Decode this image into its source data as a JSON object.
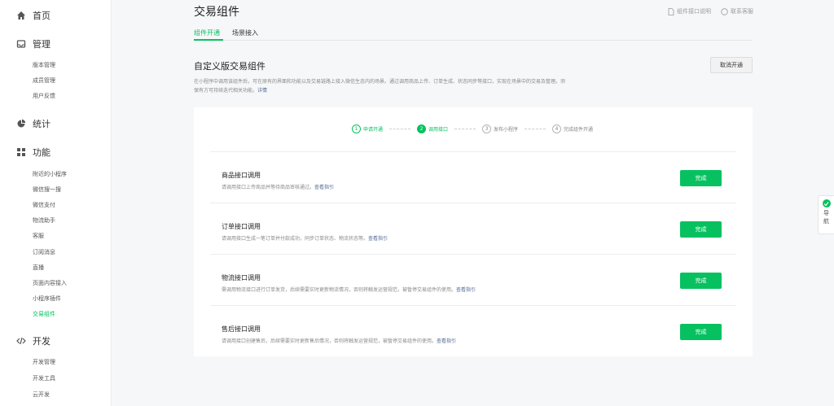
{
  "sidebar": {
    "home": {
      "label": "首页",
      "icon": "home-icon"
    },
    "manage": {
      "label": "管理",
      "icon": "inbox-icon",
      "items": [
        "版本管理",
        "成员管理",
        "用户反馈"
      ]
    },
    "stats": {
      "label": "统计",
      "icon": "pie-chart-icon"
    },
    "features": {
      "label": "功能",
      "icon": "grid-icon",
      "items": [
        "附近的小程序",
        "微信搜一搜",
        "微信支付",
        "物流助手",
        "客服",
        "订阅消息",
        "直播",
        "页面内容接入",
        "小程序插件",
        "交易组件"
      ],
      "active": "交易组件"
    },
    "dev": {
      "label": "开发",
      "icon": "code-icon",
      "items": [
        "开发管理",
        "开发工具",
        "云开发"
      ]
    }
  },
  "header": {
    "title": "交易组件",
    "doc_link": "组件接口说明",
    "contact_link": "联系客服"
  },
  "tabs": [
    {
      "label": "组件开通",
      "active": true
    },
    {
      "label": "场景接入",
      "active": false
    }
  ],
  "section": {
    "title": "自定义版交易组件",
    "cancel_button": "取消开通",
    "description": "在小程序中调用该组件后，可在原有的界面和功能以及交易链路上接入微信生态内的场景。通过调用商品上传、订单生成、状态同步等接口，实现在场景中的交易及管理。须",
    "description_line2": "保有方可持续迭代相关功能。",
    "description_link": "详情"
  },
  "steps": [
    {
      "num": "1",
      "label": "申请开通",
      "state": "done"
    },
    {
      "num": "2",
      "label": "调用接口",
      "state": "current"
    },
    {
      "num": "3",
      "label": "发布小程序",
      "state": "todo"
    },
    {
      "num": "4",
      "label": "完成组件开通",
      "state": "todo"
    }
  ],
  "rows": [
    {
      "title": "商品接口调用",
      "desc": "请调用接口上传商品并等待商品审核通过。",
      "link": "查看指引",
      "button": "完成"
    },
    {
      "title": "订单接口调用",
      "desc": "请调用接口生成一笔订单并付款成功，同步订单状态、物流状态等。",
      "link": "查看指引",
      "button": "完成"
    },
    {
      "title": "物流接口调用",
      "desc": "需调用物流接口进行订单发货，后续需要实时更新物流情况，否则将触发运营规范，被暂停交易组件的使用。",
      "link": "查看指引",
      "button": "完成"
    },
    {
      "title": "售后接口调用",
      "desc": "请调用接口创建售后，后续需要实时更新售后情况，否则将触发运营规范，被暂停交易组件的使用。",
      "link": "查看指引",
      "button": "完成"
    }
  ],
  "float_nav": {
    "label": "导航"
  },
  "colors": {
    "accent": "#07c160",
    "link": "#576b95"
  }
}
